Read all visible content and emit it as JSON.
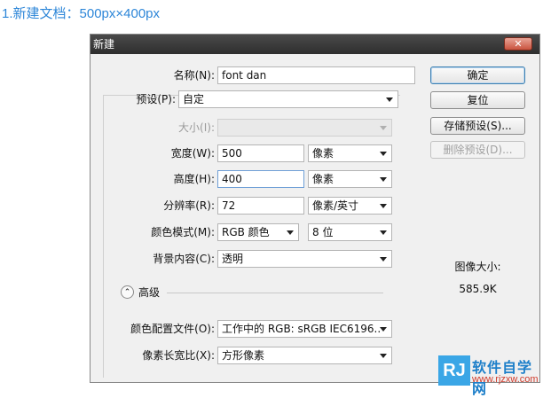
{
  "caption": "1.新建文档：500px×400px",
  "window": {
    "title": "新建",
    "close_glyph": "✕"
  },
  "form": {
    "name": {
      "label": "名称(N):",
      "value": "font dan"
    },
    "preset": {
      "label": "预设(P):",
      "value": "自定"
    },
    "size": {
      "label": "大小(I):",
      "value": ""
    },
    "width": {
      "label": "宽度(W):",
      "value": "500",
      "unit": "像素"
    },
    "height": {
      "label": "高度(H):",
      "value": "400",
      "unit": "像素"
    },
    "resolution": {
      "label": "分辨率(R):",
      "value": "72",
      "unit": "像素/英寸"
    },
    "color_mode": {
      "label": "颜色模式(M):",
      "value": "RGB 颜色",
      "depth": "8 位"
    },
    "background": {
      "label": "背景内容(C):",
      "value": "透明"
    },
    "advanced": {
      "label": "高级",
      "toggle_glyph": "⌃"
    },
    "color_profile": {
      "label": "颜色配置文件(O):",
      "value": "工作中的 RGB: sRGB IEC6196..."
    },
    "pixel_aspect": {
      "label": "像素长宽比(X):",
      "value": "方形像素"
    }
  },
  "buttons": {
    "ok": "确定",
    "reset": "复位",
    "save_preset": "存储预设(S)...",
    "delete_preset": "删除预设(D)..."
  },
  "image_size": {
    "label": "图像大小:",
    "value": "585.9K"
  },
  "logo": {
    "mark": "RJ",
    "text": "软件自学网",
    "url": "www.rjzxw.com"
  }
}
